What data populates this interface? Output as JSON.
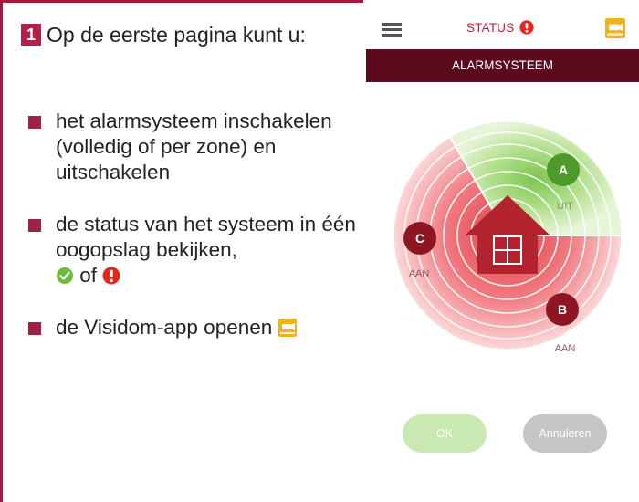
{
  "intro": {
    "step_number": "1",
    "heading": "Op de eerste pagina kunt u:"
  },
  "bullets": [
    {
      "text": "het alarmsysteem inschakelen (volledig of per zone) en uitschakelen"
    },
    {
      "text": "de status van het systeem in één oogopslag bekijken,",
      "connector": "of"
    },
    {
      "text": "de Visidom-app openen"
    }
  ],
  "icons": {
    "ok_check": "check-circle-icon",
    "alert": "exclamation-alert-icon",
    "visidom_app": "camera-app-icon",
    "menu": "hamburger-menu-icon",
    "house": "house-icon"
  },
  "app": {
    "status_label": "STATUS",
    "banner_title": "ALARMSYSTEEM",
    "zones": [
      {
        "letter": "A",
        "state": "UIT"
      },
      {
        "letter": "B",
        "state": "AAN"
      },
      {
        "letter": "C",
        "state": "AAN"
      }
    ],
    "ok_button": "OK",
    "cancel_button": "Annuleren"
  },
  "colors": {
    "accent": "#a21f45",
    "banner": "#5c0a1e",
    "armed_red": "#e8404a",
    "disarmed_green": "#8fd16a",
    "house": "#b3222f"
  }
}
